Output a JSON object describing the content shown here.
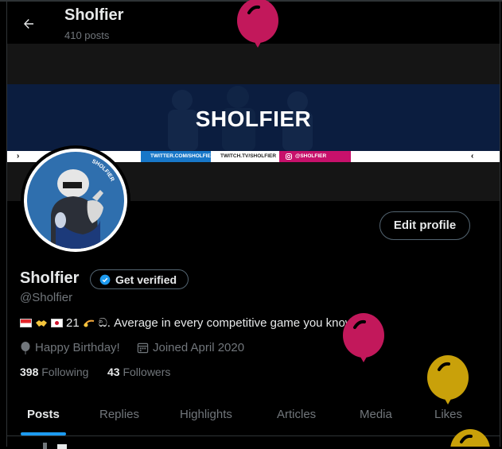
{
  "header": {
    "title": "Sholfier",
    "post_count": "410 posts"
  },
  "banner": {
    "name": "SHOLFIER",
    "twitter": "TWITTER.COM/SHOLFIER",
    "twitch": "TWITCH.TV/SHOLFIER",
    "instagram": "@SHOLFIER",
    "avatar_label": "SHOLFIER"
  },
  "profile": {
    "edit_label": "Edit profile",
    "display_name": "Sholfier",
    "verify_label": "Get verified",
    "handle": "@Sholfier",
    "bio_age": "21",
    "bio_text": "ඞ. Average in every competitive game you know.",
    "birthday": "Happy Birthday!",
    "joined": "Joined April 2020",
    "following_count": "398",
    "following_label": "Following",
    "followers_count": "43",
    "followers_label": "Followers"
  },
  "tabs": [
    "Posts",
    "Replies",
    "Highlights",
    "Articles",
    "Media",
    "Likes"
  ],
  "colors": {
    "accent": "#1d9bf0",
    "balloon_pink": "#c2185b",
    "balloon_gold": "#c9a10a"
  }
}
